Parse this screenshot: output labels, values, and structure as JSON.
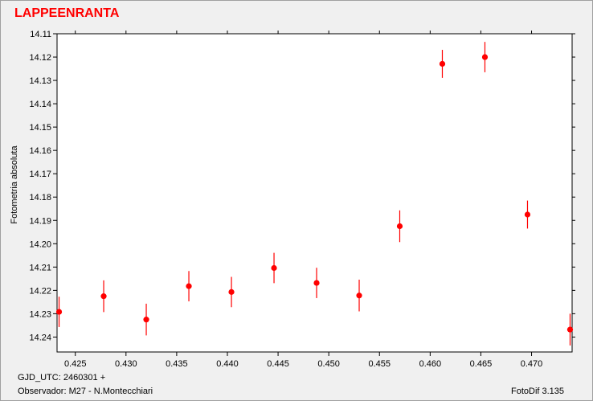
{
  "chart_data": {
    "type": "scatter",
    "title": "LAPPEENRANTA",
    "xlabel": "",
    "ylabel": "Fotometria absoluta",
    "xlim": [
      0.4232,
      0.474
    ],
    "ylim": [
      14.11,
      14.2464
    ],
    "y_inverted": true,
    "grid": false,
    "x_ticks": [
      0.425,
      0.43,
      0.435,
      0.44,
      0.445,
      0.45,
      0.455,
      0.46,
      0.465,
      0.47
    ],
    "x_tick_labels": [
      "0.425",
      "0.430",
      "0.435",
      "0.440",
      "0.445",
      "0.450",
      "0.455",
      "0.460",
      "0.465",
      "0.470"
    ],
    "y_ticks": [
      14.11,
      14.12,
      14.13,
      14.14,
      14.15,
      14.16,
      14.17,
      14.18,
      14.19,
      14.2,
      14.21,
      14.22,
      14.23,
      14.24
    ],
    "y_tick_labels": [
      "14.11",
      "14.12",
      "14.13",
      "14.14",
      "14.15",
      "14.16",
      "14.17",
      "14.18",
      "14.19",
      "14.20",
      "14.21",
      "14.22",
      "14.23",
      "14.24"
    ],
    "marker_color": "#ff0000",
    "points": [
      {
        "x": 0.4234,
        "y": 14.2292,
        "err": 0.0065
      },
      {
        "x": 0.4278,
        "y": 14.2225,
        "err": 0.0068
      },
      {
        "x": 0.432,
        "y": 14.2325,
        "err": 0.0068
      },
      {
        "x": 0.4362,
        "y": 14.2182,
        "err": 0.0065
      },
      {
        "x": 0.4404,
        "y": 14.2207,
        "err": 0.0065
      },
      {
        "x": 0.4446,
        "y": 14.2104,
        "err": 0.0065
      },
      {
        "x": 0.4488,
        "y": 14.2168,
        "err": 0.0065
      },
      {
        "x": 0.453,
        "y": 14.2222,
        "err": 0.0068
      },
      {
        "x": 0.457,
        "y": 14.1925,
        "err": 0.0068
      },
      {
        "x": 0.4612,
        "y": 14.1229,
        "err": 0.006
      },
      {
        "x": 0.4654,
        "y": 14.12,
        "err": 0.0065
      },
      {
        "x": 0.4696,
        "y": 14.1875,
        "err": 0.006
      },
      {
        "x": 0.4738,
        "y": 14.2368,
        "err": 0.0068
      }
    ]
  },
  "footer": {
    "gjd": "GJD_UTC: 2460301 +",
    "observer": "Observador: M27 - N.Montecchiari",
    "software": "FotoDif 3.135"
  }
}
